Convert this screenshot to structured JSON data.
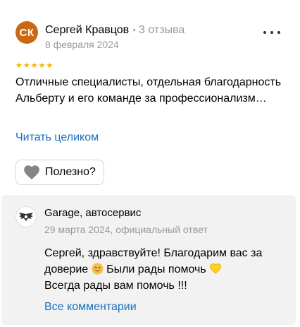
{
  "review": {
    "avatar_initials": "СК",
    "avatar_color": "#c96a13",
    "author_name": "Сергей Кравцов",
    "review_count": "3 отзыва",
    "date": "8 февраля 2024",
    "rating": 5,
    "text": "Отличные специалисты, отдельная благодарность Альберту и его команде за профессионализм…",
    "read_more_label": "Читать целиком",
    "helpful_label": "Полезно?"
  },
  "reply": {
    "org_name": "Garage, автосервис",
    "meta": "29 марта 2024, официальный ответ",
    "text_part1": "Сергей, здравствуйте! Благодарим вас за доверие ",
    "text_part2": " Были рады помочь ",
    "text_line2": "Всегда рады вам помочь !!!",
    "emoji_face": "smiling-face-emoji",
    "emoji_heart": "yellow-heart-emoji",
    "all_comments_label": "Все комментарии"
  },
  "colors": {
    "link": "#1a6ebf",
    "star": "#f6b400",
    "reply_bg": "#f2f2f2",
    "muted": "#999999"
  }
}
